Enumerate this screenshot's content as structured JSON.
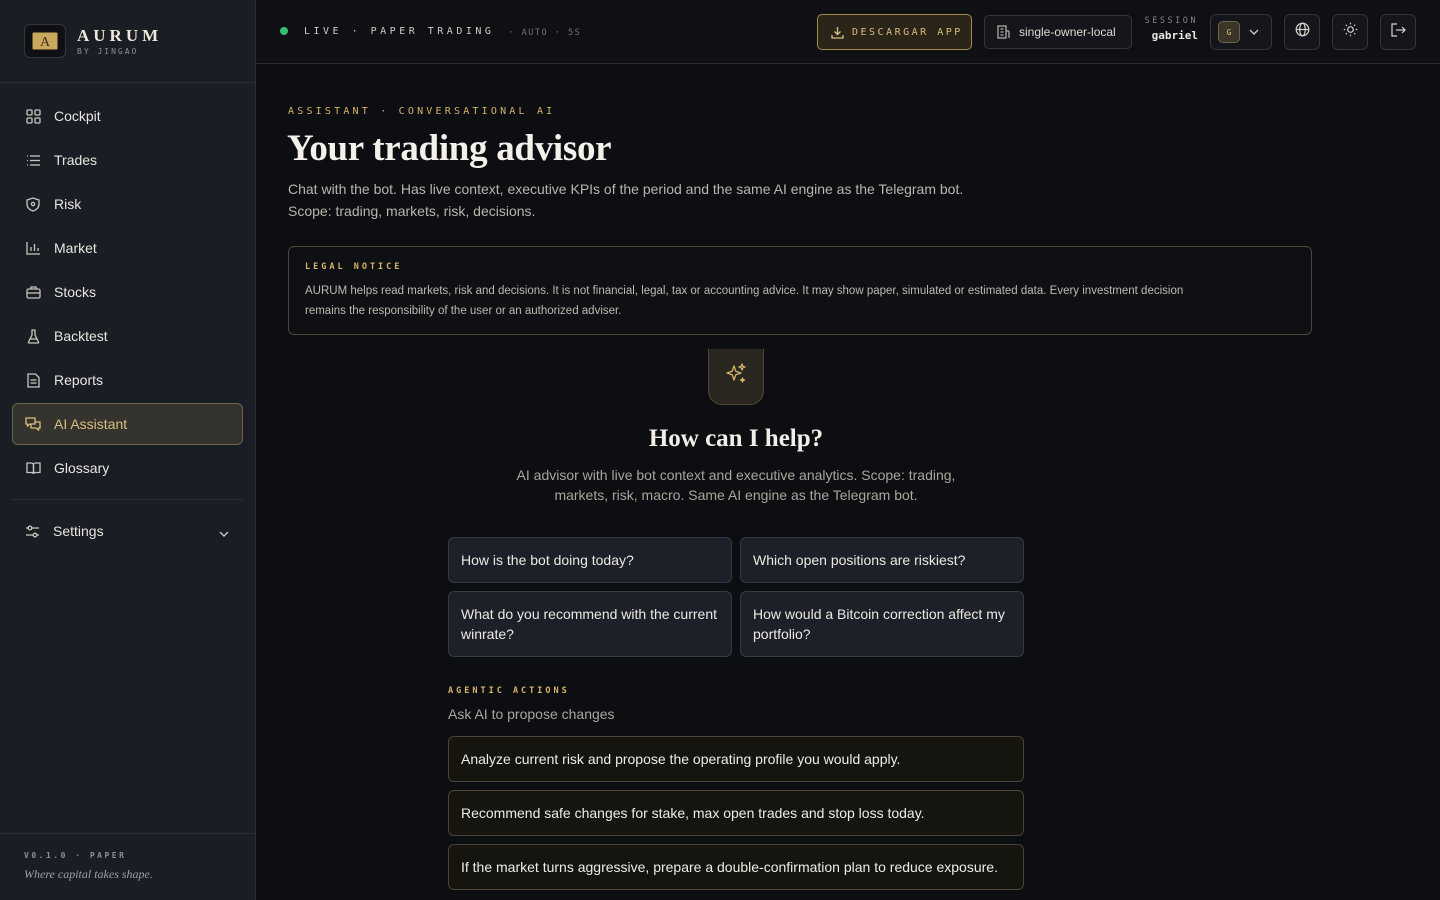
{
  "brand": {
    "name": "AURUM",
    "sub": "BY JINGAO",
    "logo_letter": "A"
  },
  "sidebar": {
    "items": [
      {
        "label": "Cockpit",
        "icon": "grid-icon"
      },
      {
        "label": "Trades",
        "icon": "list-icon"
      },
      {
        "label": "Risk",
        "icon": "shield-icon"
      },
      {
        "label": "Market",
        "icon": "bar-chart-icon"
      },
      {
        "label": "Stocks",
        "icon": "briefcase-icon"
      },
      {
        "label": "Backtest",
        "icon": "flask-icon"
      },
      {
        "label": "Reports",
        "icon": "document-icon"
      },
      {
        "label": "AI Assistant",
        "icon": "chat-icon",
        "active": true
      },
      {
        "label": "Glossary",
        "icon": "book-icon"
      }
    ],
    "settings_label": "Settings",
    "version": "V0.1.0 · PAPER",
    "tagline": "Where capital takes shape."
  },
  "topbar": {
    "status": "LIVE · PAPER TRADING",
    "auto": "· AUTO · 5S",
    "download_label": "DESCARGAR APP",
    "tenant": "single-owner-local",
    "session_label": "SESSION",
    "session_user": "gabriel",
    "avatar_initial": "G"
  },
  "page": {
    "eyebrow": "ASSISTANT · CONVERSATIONAL AI",
    "title": "Your trading advisor",
    "description": "Chat with the bot. Has live context, executive KPIs of the period and the same AI engine as the Telegram bot. Scope: trading, markets, risk, decisions."
  },
  "legal": {
    "title": "LEGAL NOTICE",
    "text": "AURUM helps read markets, risk and decisions. It is not financial, legal, tax or accounting advice. It may show paper, simulated or estimated data. Every investment decision remains the responsibility of the user or an authorized adviser."
  },
  "help": {
    "title": "How can I help?",
    "description": "AI advisor with live bot context and executive analytics. Scope: trading, markets, risk, macro. Same AI engine as the Telegram bot."
  },
  "suggestions": [
    "How is the bot doing today?",
    "Which open positions are riskiest?",
    "What do you recommend with the current winrate?",
    "How would a Bitcoin correction affect my portfolio?"
  ],
  "agentic": {
    "label": "AGENTIC ACTIONS",
    "subtitle": "Ask AI to propose changes",
    "actions": [
      "Analyze current risk and propose the operating profile you would apply.",
      "Recommend safe changes for stake, max open trades and stop loss today.",
      "If the market turns aggressive, prepare a double-confirmation plan to reduce exposure."
    ]
  },
  "colors": {
    "accent": "#d8b36a",
    "live": "#34c06e",
    "background": "#0d0e12",
    "sidebar": "#1a1d24"
  }
}
